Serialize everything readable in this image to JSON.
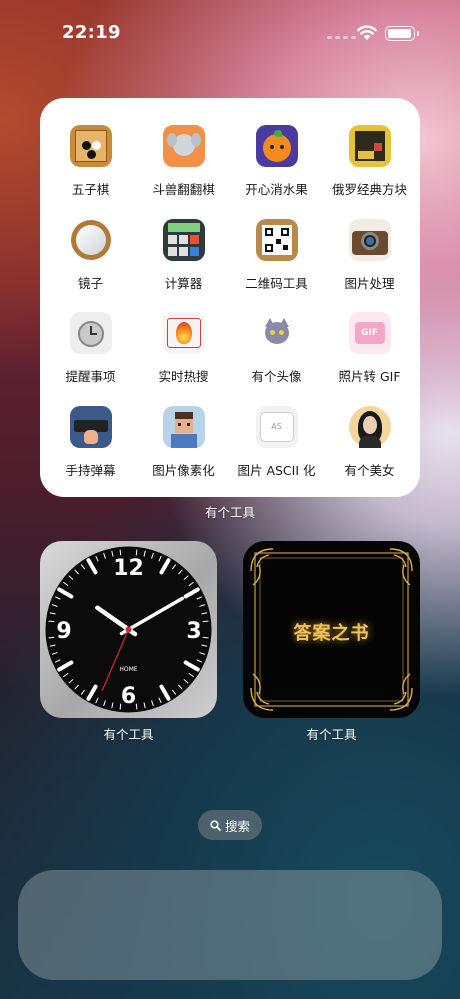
{
  "status_bar": {
    "time": "22:19",
    "battery_level": 0.95
  },
  "tools_widget": {
    "caption": "有个工具",
    "apps": [
      {
        "label": "五子棋",
        "icon": "gomoku-icon"
      },
      {
        "label": "斗兽翻翻棋",
        "icon": "elephant-chess-icon"
      },
      {
        "label": "开心消水果",
        "icon": "orange-fruit-icon"
      },
      {
        "label": "俄罗经典方块",
        "icon": "tetris-icon"
      },
      {
        "label": "镜子",
        "icon": "mirror-icon"
      },
      {
        "label": "计算器",
        "icon": "calculator-icon"
      },
      {
        "label": "二维码工具",
        "icon": "qr-code-icon"
      },
      {
        "label": "图片处理",
        "icon": "camera-icon"
      },
      {
        "label": "提醒事项",
        "icon": "alarm-clock-icon"
      },
      {
        "label": "实时热搜",
        "icon": "fire-trending-icon"
      },
      {
        "label": "有个头像",
        "icon": "cat-avatar-icon"
      },
      {
        "label": "照片转 GIF",
        "icon": "gif-icon"
      },
      {
        "label": "手持弹幕",
        "icon": "handheld-danmaku-icon"
      },
      {
        "label": "图片像素化",
        "icon": "pixel-portrait-icon"
      },
      {
        "label": "图片 ASCII 化",
        "icon": "ascii-icon"
      },
      {
        "label": "有个美女",
        "icon": "beauty-portrait-icon"
      }
    ]
  },
  "clock_widget": {
    "caption": "有个工具",
    "brand": "HOME",
    "numerals": [
      "12",
      "3",
      "6",
      "9"
    ],
    "hour": 10,
    "minute": 10
  },
  "book_widget": {
    "caption": "有个工具",
    "title": "答案之书"
  },
  "search_pill": {
    "label": "搜索"
  }
}
